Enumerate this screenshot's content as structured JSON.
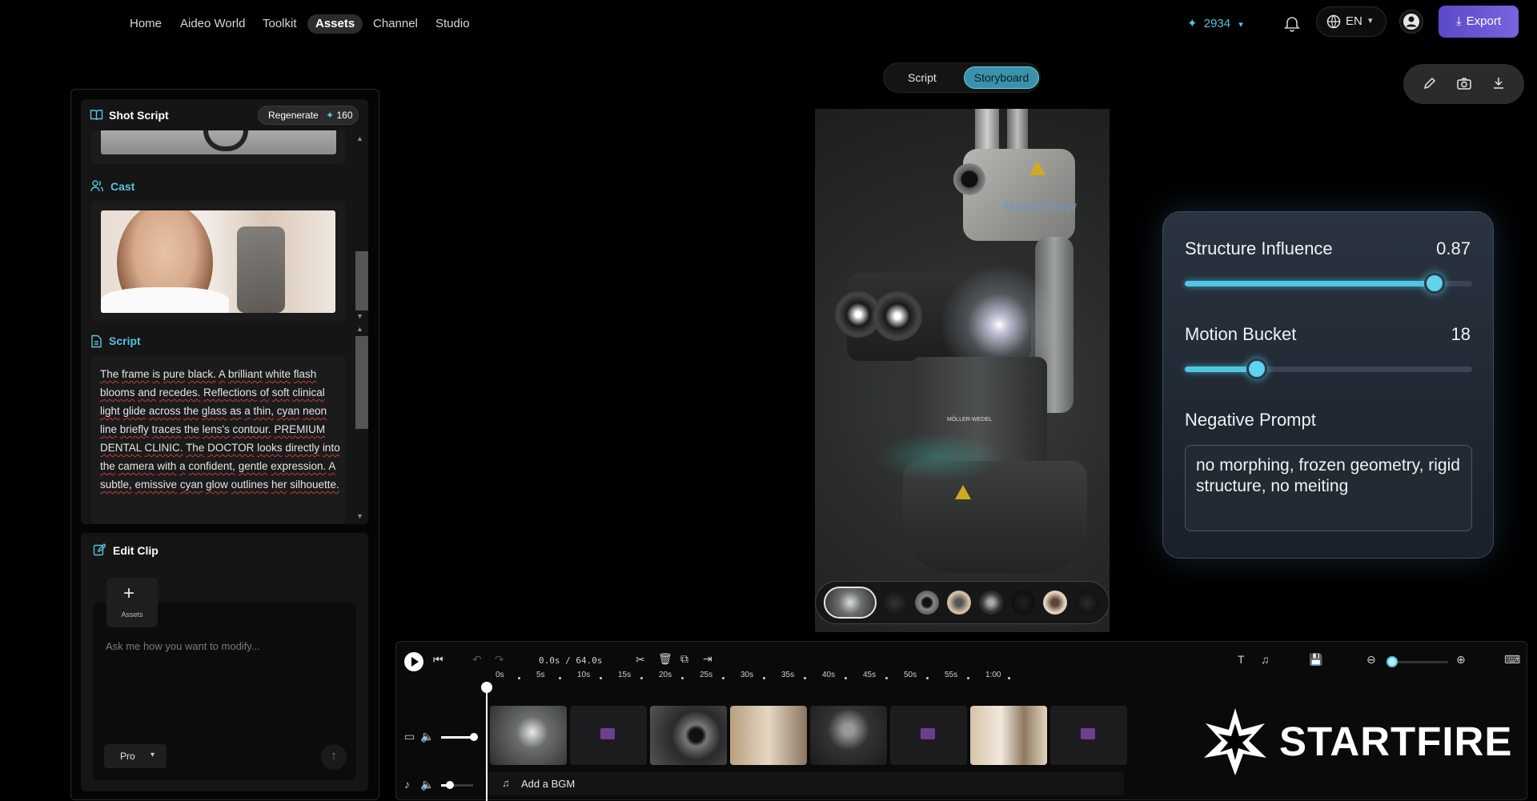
{
  "nav": {
    "items": [
      "Home",
      "Aideo World",
      "Toolkit",
      "Assets",
      "Channel",
      "Studio"
    ],
    "active": "Assets",
    "credits": "2934",
    "language": "EN",
    "export_label": "Export"
  },
  "view_toggle": {
    "script_label": "Script",
    "storyboard_label": "Storyboard",
    "active": "Storyboard"
  },
  "shot_script": {
    "title": "Shot Script",
    "regenerate_label": "Regenerate",
    "regenerate_cost": "160",
    "cast_title": "Cast",
    "script_title": "Script",
    "script_words": [
      "The",
      "frame",
      "is",
      "pure",
      "black.",
      "A",
      "brilliant",
      "white",
      "flash",
      "blooms",
      "and",
      "recedes.",
      "Reflections",
      "of",
      "soft",
      "clinical",
      "light",
      "glide",
      "across",
      "the",
      "glass",
      "as",
      "a",
      "thin,",
      "cyan",
      "neon",
      "line",
      "briefly",
      "traces",
      "the",
      "lens's",
      "contour.",
      "PREMIUM",
      "DENTAL",
      "CLINIC.",
      "The",
      "DOCTOR",
      "looks",
      "directly",
      "into",
      "the",
      "camera",
      "with",
      "a",
      "confident,",
      "gentle",
      "expression.",
      "A",
      "subtle,",
      "emissive",
      "cyan",
      "glow",
      "outlines",
      "her",
      "silhouette."
    ]
  },
  "edit_clip": {
    "title": "Edit Clip",
    "assets_label": "Assets",
    "placeholder": "Ask me how you want to modify...",
    "model": "Pro"
  },
  "preview": {
    "watermark": "MovieFlow",
    "scope_label": "MÖLLER-WEDEL"
  },
  "settings": {
    "structure_label": "Structure Influence",
    "structure_value": "0.87",
    "structure_fraction": 0.87,
    "motion_label": "Motion Bucket",
    "motion_value": "18",
    "motion_fraction": 0.25,
    "negative_label": "Negative Prompt",
    "negative_text": "no morphing, frozen geometry, rigid structure, no meiting"
  },
  "timeline": {
    "time_display": "0.0s / 64.0s",
    "ruler": [
      "0s",
      "5s",
      "10s",
      "15s",
      "20s",
      "25s",
      "30s",
      "35s",
      "40s",
      "45s",
      "50s",
      "55s",
      "1:00"
    ],
    "bgm_label": "Add a BGM",
    "zoom_fraction": 0.0
  },
  "brand": {
    "logo_text": "STARTFIRE"
  },
  "colors": {
    "accent": "#4fc6e3",
    "export": "#6a56d6",
    "background": "#000000"
  }
}
